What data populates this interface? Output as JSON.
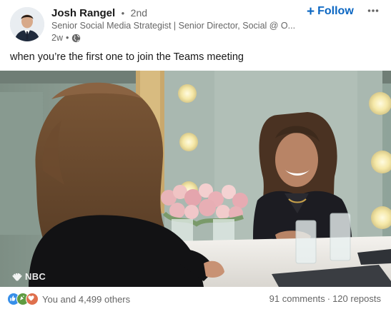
{
  "post": {
    "author": {
      "name": "Josh Rangel",
      "degree": "2nd",
      "headline": "Senior Social Media Strategist | Senior Director, Social @ O...",
      "time": "2w"
    },
    "follow_label": "Follow",
    "text": "when you’re the first one to join the Teams meeting",
    "media": {
      "watermark": "NBC"
    },
    "social": {
      "reactions_text": "You and 4,499 others",
      "comments": "91 comments",
      "reposts": "120 reposts",
      "reaction_icons": [
        "like-icon",
        "celebrate-icon",
        "love-icon"
      ]
    }
  },
  "colors": {
    "brand": "#0a66c2",
    "secondary_text": "#666666"
  }
}
